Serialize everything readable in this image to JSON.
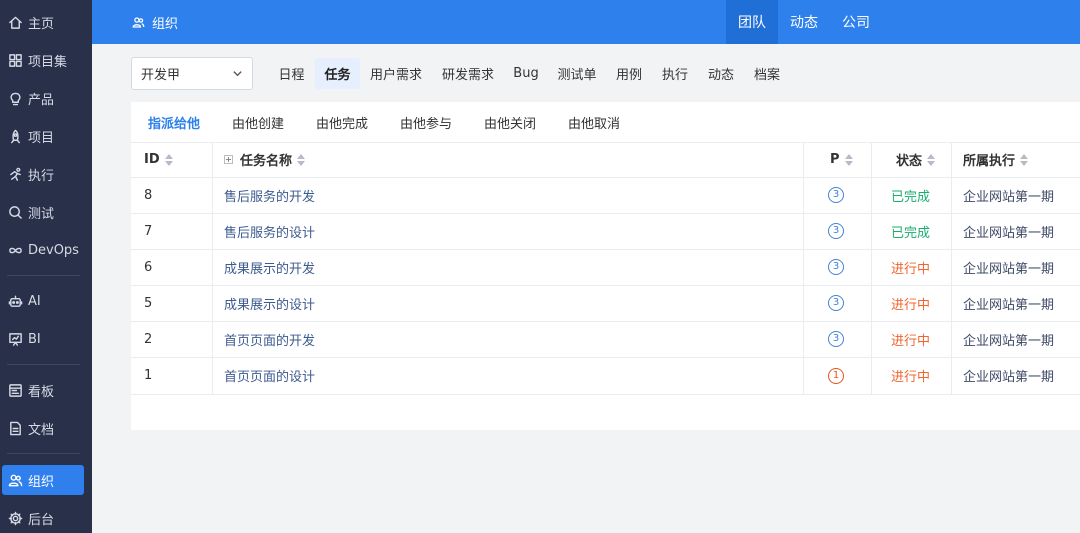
{
  "sidebar": {
    "items": [
      {
        "label": "主页",
        "icon": "home-icon"
      },
      {
        "label": "项目集",
        "icon": "grid-icon"
      },
      {
        "label": "产品",
        "icon": "bulb-icon"
      },
      {
        "label": "项目",
        "icon": "rocket-icon"
      },
      {
        "label": "执行",
        "icon": "run-icon"
      },
      {
        "label": "测试",
        "icon": "search-icon"
      },
      {
        "label": "DevOps",
        "icon": "infinity-icon"
      },
      {
        "label": "AI",
        "icon": "robot-icon"
      },
      {
        "label": "BI",
        "icon": "chart-board-icon"
      },
      {
        "label": "看板",
        "icon": "kanban-icon"
      },
      {
        "label": "文档",
        "icon": "document-icon"
      },
      {
        "label": "组织",
        "icon": "users-icon"
      },
      {
        "label": "后台",
        "icon": "gear-icon"
      }
    ],
    "active_label": "组织"
  },
  "header": {
    "title": "组织",
    "tabs": [
      "团队",
      "动态",
      "公司"
    ],
    "active_tab": "团队"
  },
  "toolbar": {
    "dept_select": "开发甲",
    "tabs": [
      "日程",
      "任务",
      "用户需求",
      "研发需求",
      "Bug",
      "测试单",
      "用例",
      "执行",
      "动态",
      "档案"
    ],
    "active_tab": "任务"
  },
  "filters": {
    "tabs": [
      "指派给他",
      "由他创建",
      "由他完成",
      "由他参与",
      "由他关闭",
      "由他取消"
    ],
    "active_tab": "指派给他"
  },
  "table": {
    "columns": {
      "id": "ID",
      "name": "任务名称",
      "priority": "P",
      "status": "状态",
      "execution": "所属执行"
    },
    "rows": [
      {
        "id": "8",
        "name": "售后服务的开发",
        "priority": "3",
        "status": "已完成",
        "execution": "企业网站第一期"
      },
      {
        "id": "7",
        "name": "售后服务的设计",
        "priority": "3",
        "status": "已完成",
        "execution": "企业网站第一期"
      },
      {
        "id": "6",
        "name": "成果展示的开发",
        "priority": "3",
        "status": "进行中",
        "execution": "企业网站第一期"
      },
      {
        "id": "5",
        "name": "成果展示的设计",
        "priority": "3",
        "status": "进行中",
        "execution": "企业网站第一期"
      },
      {
        "id": "2",
        "name": "首页页面的开发",
        "priority": "3",
        "status": "进行中",
        "execution": "企业网站第一期"
      },
      {
        "id": "1",
        "name": "首页页面的设计",
        "priority": "1",
        "status": "进行中",
        "execution": "企业网站第一期"
      }
    ]
  },
  "colors": {
    "accent": "#2e80ed",
    "sidebar_bg": "#28304a",
    "status_done": "#1aae6f",
    "status_doing": "#f0652f",
    "priority_normal": "#3d84d6",
    "priority_high": "#e8541e"
  }
}
